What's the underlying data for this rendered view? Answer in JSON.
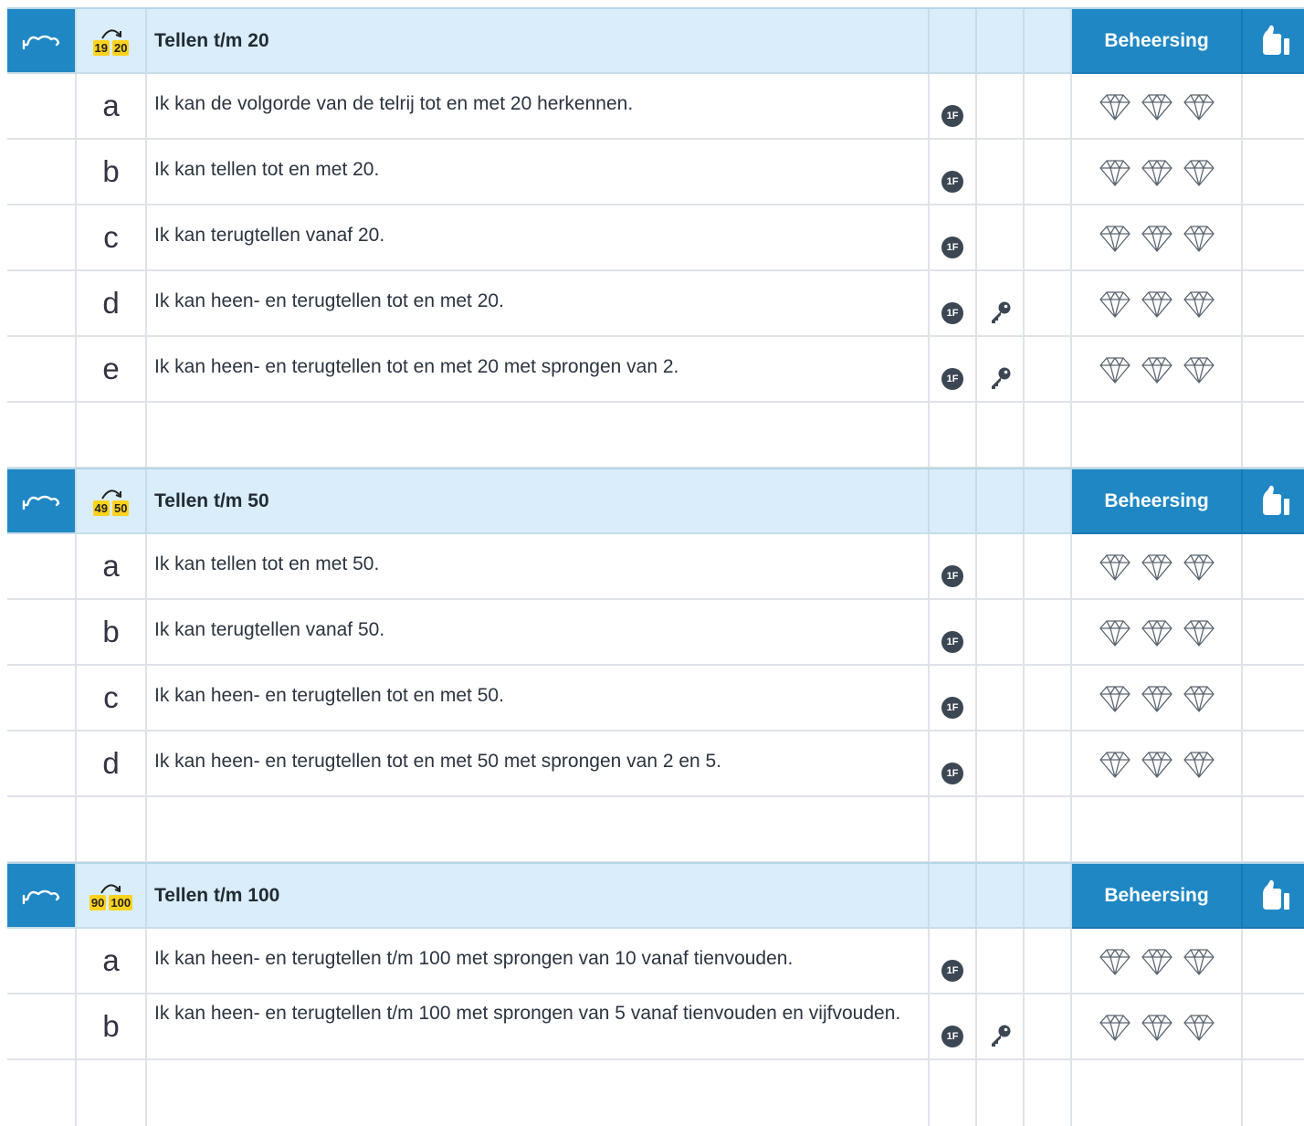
{
  "sections": [
    {
      "title": "Tellen t/m 20",
      "mastery_label": "Beheersing",
      "icon_numbers": [
        "19",
        "20"
      ],
      "items": [
        {
          "letter": "a",
          "text": "Ik kan de volgorde van de telrij tot en met 20 herkennen.",
          "level": "1F",
          "key": false
        },
        {
          "letter": "b",
          "text": "Ik kan tellen tot en met 20.",
          "level": "1F",
          "key": false
        },
        {
          "letter": "c",
          "text": "Ik kan terugtellen vanaf 20.",
          "level": "1F",
          "key": false
        },
        {
          "letter": "d",
          "text": "Ik kan heen- en terugtellen tot en met 20.",
          "level": "1F",
          "key": true
        },
        {
          "letter": "e",
          "text": "Ik kan heen- en terugtellen tot en met 20 met sprongen van 2.",
          "level": "1F",
          "key": true
        }
      ]
    },
    {
      "title": "Tellen t/m 50",
      "mastery_label": "Beheersing",
      "icon_numbers": [
        "49",
        "50"
      ],
      "items": [
        {
          "letter": "a",
          "text": "Ik kan tellen tot en met 50.",
          "level": "1F",
          "key": false
        },
        {
          "letter": "b",
          "text": "Ik kan terugtellen vanaf 50.",
          "level": "1F",
          "key": false
        },
        {
          "letter": "c",
          "text": "Ik kan heen- en terugtellen tot en met 50.",
          "level": "1F",
          "key": false
        },
        {
          "letter": "d",
          "text": "Ik kan heen- en terugtellen tot en met 50 met sprongen van 2 en 5.",
          "level": "1F",
          "key": false
        }
      ]
    },
    {
      "title": "Tellen t/m 100",
      "mastery_label": "Beheersing",
      "icon_numbers": [
        "90",
        "100"
      ],
      "items": [
        {
          "letter": "a",
          "text": "Ik kan heen- en terugtellen t/m 100 met sprongen van 10 vanaf tienvouden.",
          "level": "1F",
          "key": false
        },
        {
          "letter": "b",
          "text": "Ik kan heen- en terugtellen t/m 100 met sprongen van 5 vanaf tienvouden en vijfvouden.",
          "level": "1F",
          "key": true
        }
      ]
    }
  ],
  "icons": {
    "section_left": "jump-arc-icon",
    "section_count": "counting-jump-icon",
    "mastery_right": "thumbs-up-icon",
    "level_badge": "level-badge",
    "key": "key-icon",
    "rating": "diamond-icon"
  },
  "colors": {
    "header_blue": "#1e87c4",
    "header_light": "#d9eefa",
    "badge_dark": "#3c4753",
    "number_yellow": "#ffd21e",
    "grid_line": "#dfe3e8"
  }
}
